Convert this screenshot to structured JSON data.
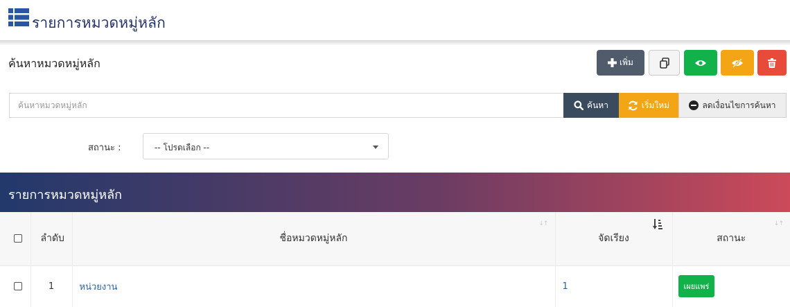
{
  "page": {
    "title": "รายการหมวดหมู่หลัก"
  },
  "search": {
    "heading": "ค้นหาหมวดหมู่หลัก",
    "placeholder": "ค้นหาหมวดหมู่หลัก",
    "search_label": "ค้นหา",
    "reset_label": "เริ่มใหม่",
    "clear_label": "ลดเงื่อนไขการค้นหา"
  },
  "toolbar": {
    "add_label": "เพิ่ม"
  },
  "filter": {
    "status_label": "สถานะ :",
    "status_selected": "-- โปรดเลือก --"
  },
  "list": {
    "title": "รายการหมวดหมู่หลัก",
    "columns": {
      "order": "ลำดับ",
      "name": "ชื่อหมวดหมู่หลัก",
      "sort": "จัดเรียง",
      "status": "สถานะ"
    },
    "rows": [
      {
        "order": "1",
        "name": "หน่วยงาน",
        "sort": "1",
        "status": "เผยแพร่"
      }
    ]
  },
  "colors": {
    "primary_dark": "#505b6b",
    "success": "#12b24a",
    "warning": "#f3a516",
    "danger": "#e94b3b",
    "gradient_start": "#22396b",
    "gradient_end": "#cc4a59",
    "link": "#2a62a8"
  },
  "icons": [
    "list-icon",
    "plus-icon",
    "copy-icon",
    "eye-icon",
    "eye-slash-icon",
    "trash-icon",
    "search-icon",
    "refresh-icon",
    "minus-circle-icon",
    "sort-icon",
    "sort-amount-icon"
  ]
}
